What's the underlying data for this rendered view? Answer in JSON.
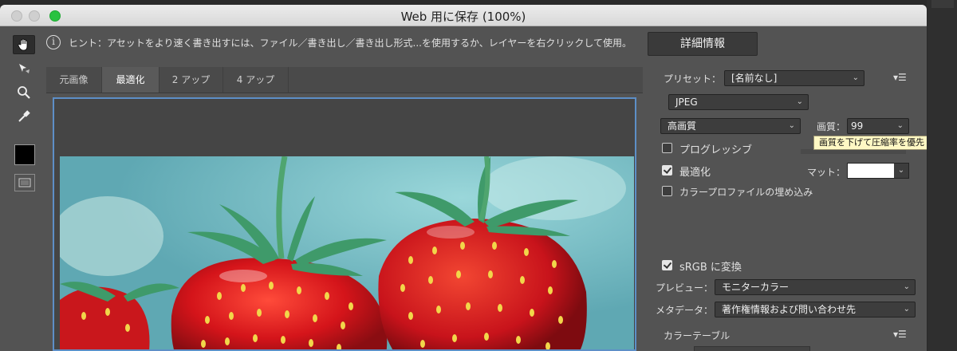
{
  "window": {
    "title": "Web 用に保存 (100%)"
  },
  "hint": {
    "icon": "info-icon",
    "text": "ヒント：アセットをより速く書き出すには、ファイル／書き出し／書き出し形式...を使用するか、レイヤーを右クリックして使用。"
  },
  "detail_button": "詳細情報",
  "tabs": [
    "元画像",
    "最適化",
    "2 アップ",
    "4 アップ"
  ],
  "tools": [
    "hand-tool-icon",
    "slice-select-tool-icon",
    "zoom-tool-icon",
    "eyedropper-tool-icon"
  ],
  "settings": {
    "preset_label": "プリセット：",
    "preset_value": "[名前なし]",
    "format": "JPEG",
    "quality_preset": "高画質",
    "quality_label": "画質：",
    "quality_value": "99",
    "tooltip": "画質を下げて圧縮率を優先",
    "progressive": {
      "label": "プログレッシブ",
      "checked": false
    },
    "optimized": {
      "label": "最適化",
      "checked": true
    },
    "matte_label": "マット：",
    "embed_profile": {
      "label": "カラープロファイルの埋め込み",
      "checked": false
    },
    "srgb": {
      "label": "sRGB に変換",
      "checked": true
    },
    "preview_label": "プレビュー：",
    "preview_value": "モニターカラー",
    "metadata_label": "メタデータ：",
    "metadata_value": "著作権情報および問い合わせ先",
    "color_table_label": "カラーテーブル"
  },
  "colors": {
    "accent": "#5d8fc7",
    "matte": "#ffffff",
    "green_button": "#29c240"
  }
}
